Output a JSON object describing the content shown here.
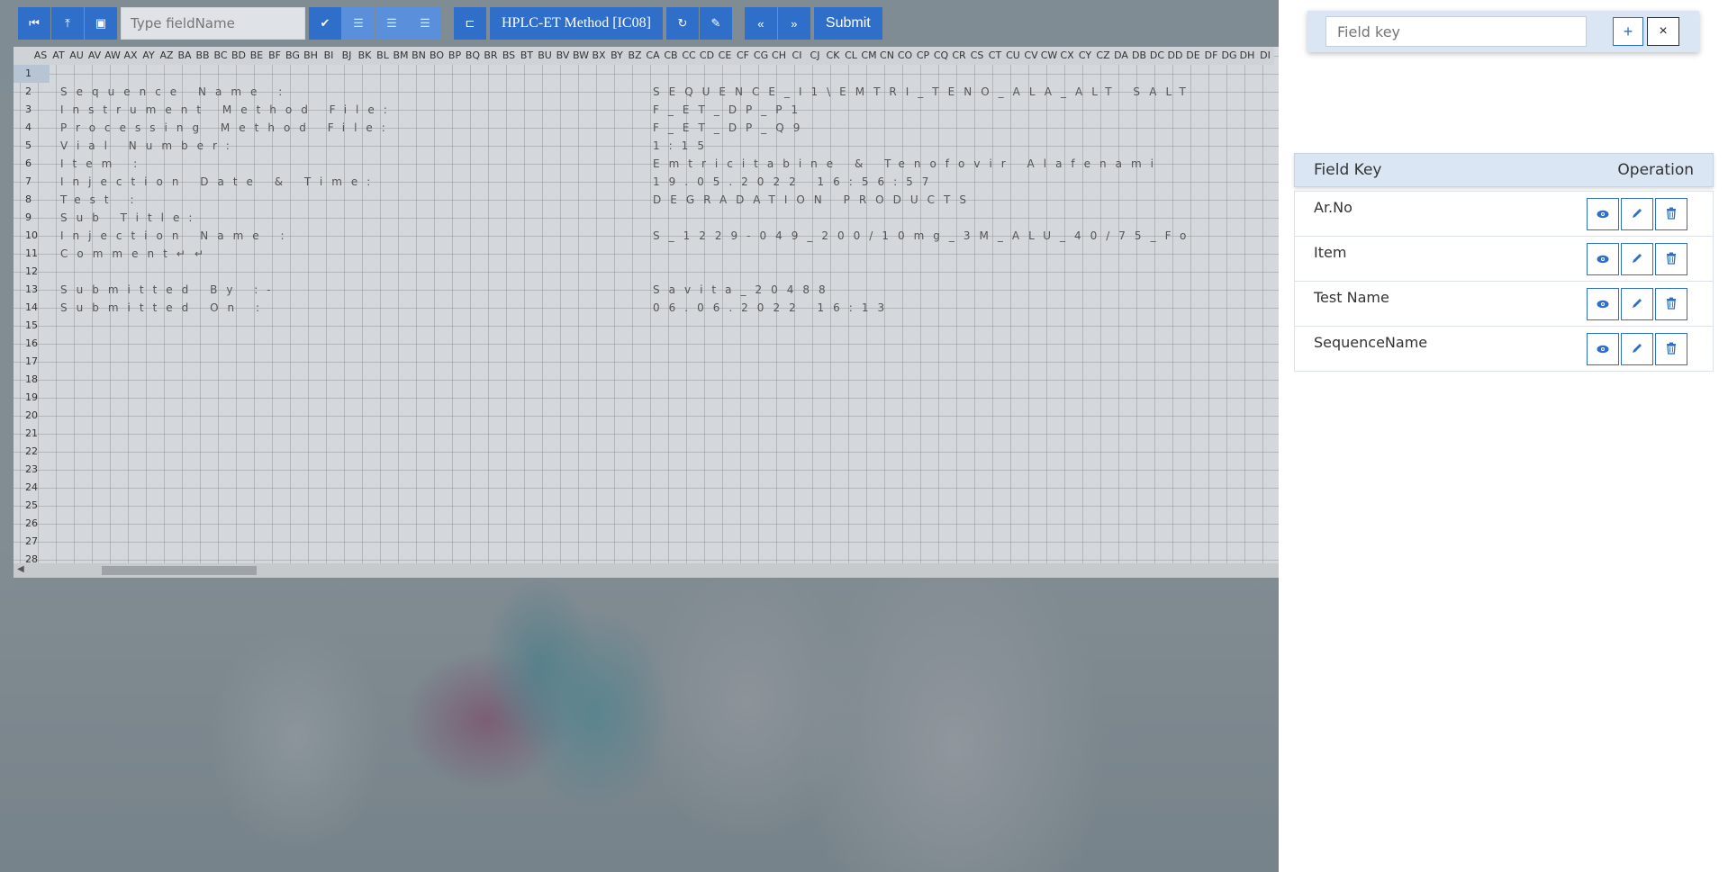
{
  "toolbar": {
    "field_placeholder": "Type fieldName",
    "method_label": "HPLC-ET Method [IC08]",
    "submit_label": "Submit"
  },
  "sheet": {
    "columns": [
      "AS",
      "AT",
      "AU",
      "AV",
      "AW",
      "AX",
      "AY",
      "AZ",
      "BA",
      "BB",
      "BC",
      "BD",
      "BE",
      "BF",
      "BG",
      "BH",
      "BI",
      "BJ",
      "BK",
      "BL",
      "BM",
      "BN",
      "BO",
      "BP",
      "BQ",
      "BR",
      "BS",
      "BT",
      "BU",
      "BV",
      "BW",
      "BX",
      "BY",
      "BZ",
      "CA",
      "CB",
      "CC",
      "CD",
      "CE",
      "CF",
      "CG",
      "CH",
      "CI",
      "CJ",
      "CK",
      "CL",
      "CM",
      "CN",
      "CO",
      "CP",
      "CQ",
      "CR",
      "CS",
      "CT",
      "CU",
      "CV",
      "CW",
      "CX",
      "CY",
      "CZ",
      "DA",
      "DB",
      "DC",
      "DD",
      "DE",
      "DF",
      "DG",
      "DH",
      "DI"
    ],
    "rows": [
      "1",
      "2",
      "3",
      "4",
      "5",
      "6",
      "7",
      "8",
      "9",
      "10",
      "11",
      "12",
      "13",
      "14",
      "15",
      "16",
      "17",
      "18",
      "19",
      "20",
      "21",
      "22",
      "23",
      "24",
      "25",
      "26",
      "27",
      "28"
    ],
    "labels": {
      "r2": "Sequence Name :",
      "r3": "Instrument Method File:",
      "r4": "Processing Method File:",
      "r5": "Vial Number:",
      "r6": "Item :",
      "r7": "Injection Date & Time:",
      "r8": "Test :",
      "r9": "Sub Title:",
      "r10": "Injection Name :",
      "r11": "Comment↵↵",
      "r13": "Submitted By :-",
      "r14": "Submitted On :"
    },
    "values": {
      "r2": "SEQUENCE_I1\\EMTRI_TENO_ALA_ALT SALT",
      "r3": "F_ET_DP_P1",
      "r4": "F_ET_DP_Q9",
      "r5": "1:15",
      "r6": "Emtricitabine & Tenofovir Alafenami",
      "r7": "19.05.2022 16:56:57",
      "r8": "DEGRADATION PRODUCTS",
      "r10": "S_1229-049_200/10mg_3M_ALU_40/75_Fo",
      "r13": "Savita_20488",
      "r14": "06.06.2022 16:13"
    }
  },
  "panel": {
    "key_placeholder": "Field key",
    "add_label": "+",
    "close_label": "×",
    "header_key": "Field Key",
    "header_op": "Operation",
    "rows": [
      "Ar.No",
      "Item",
      "Test Name",
      "SequenceName"
    ]
  }
}
